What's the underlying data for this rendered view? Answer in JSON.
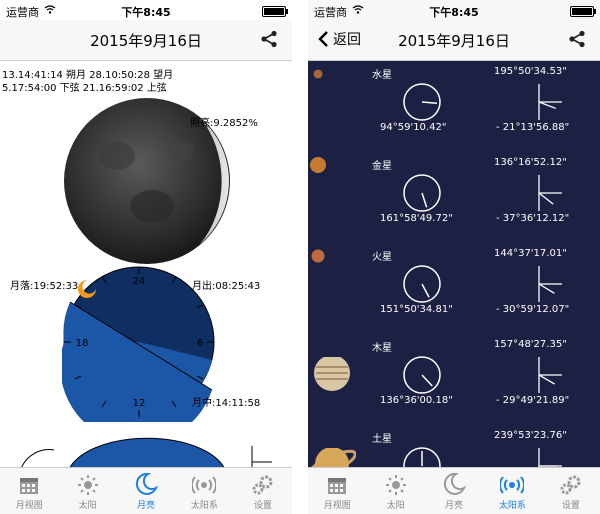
{
  "status": {
    "carrier": "运营商",
    "time": "下午8:45"
  },
  "moon_screen": {
    "title": "2015年9月16日",
    "phase_times": {
      "line1": "13.14:41:14 朔月  28.10:50:28 望月",
      "line2": "5.17:54:00 下弦  21.16:59:02 上弦"
    },
    "illumination": "照亮:9.2852%",
    "moonset": "月落:19:52:33",
    "moonrise": "月出:08:25:43",
    "transit": "月中:14:11:58",
    "dial_labels": [
      "24",
      "6",
      "12",
      "18"
    ]
  },
  "planet_screen": {
    "title": "2015年9月16日",
    "back_label": "返回",
    "planets": [
      {
        "name": "水星",
        "ra": "195°50'34.53\"",
        "az": "94°59'10.42\"",
        "alt": "- 21°13'56.88\"",
        "color": "#a5683a",
        "size": 9,
        "az_angle": 95,
        "alt_angle": -21
      },
      {
        "name": "金星",
        "ra": "136°16'52.12\"",
        "az": "161°58'49.72\"",
        "alt": "- 37°36'12.12\"",
        "color": "#c77b2e",
        "size": 16,
        "az_angle": 162,
        "alt_angle": -38
      },
      {
        "name": "火星",
        "ra": "144°37'17.01\"",
        "az": "151°50'34.81\"",
        "alt": "- 30°59'12.07\"",
        "color": "#c06a3e",
        "size": 13,
        "az_angle": 152,
        "alt_angle": -31
      },
      {
        "name": "木星",
        "ra": "157°48'27.35\"",
        "az": "136°36'00.18\"",
        "alt": "- 29°49'21.89\"",
        "color": "#d8c6a4",
        "size": 36,
        "az_angle": 137,
        "alt_angle": -30
      },
      {
        "name": "土星",
        "ra": "239°53'23.76\"",
        "az": "",
        "alt": "",
        "color": "#d8a85a",
        "size": 34,
        "az_angle": 0,
        "alt_angle": 0
      }
    ]
  },
  "tabs": [
    "月视图",
    "太阳",
    "月亮",
    "太阳系",
    "设置"
  ],
  "colors": {
    "accent": "#1e7fe0",
    "dial_dark": "#0f2f63",
    "dial_light": "#1b57a6",
    "space": "#1c2042"
  }
}
